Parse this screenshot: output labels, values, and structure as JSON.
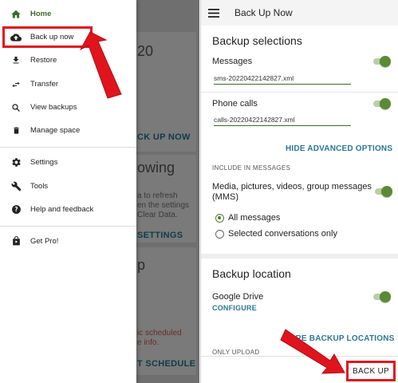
{
  "left_panel": {
    "background_app": {
      "card1_title": "20",
      "card1_button": "CK UP NOW",
      "card2_title": "owing",
      "card2_text": [
        "a to refresh",
        "en the settings",
        "Clear Data."
      ],
      "card2_button": "SETTINGS",
      "card3_title": "p",
      "card3_red_text": [
        "ic scheduled",
        "e info."
      ],
      "card3_button": "T SCHEDULE"
    },
    "drawer": {
      "items": [
        {
          "label": "Home",
          "icon": "home-icon"
        },
        {
          "label": "Back up now",
          "icon": "cloud-upload-icon"
        },
        {
          "label": "Restore",
          "icon": "download-icon"
        },
        {
          "label": "Transfer",
          "icon": "transfer-icon"
        },
        {
          "label": "View backups",
          "icon": "search-icon"
        },
        {
          "label": "Manage space",
          "icon": "trash-icon"
        },
        {
          "label": "Settings",
          "icon": "gear-icon"
        },
        {
          "label": "Tools",
          "icon": "wrench-icon"
        },
        {
          "label": "Help and feedback",
          "icon": "help-icon"
        },
        {
          "label": "Get Pro!",
          "icon": "pro-bag-icon"
        }
      ]
    }
  },
  "right_panel": {
    "appbar": {
      "title": "Back Up Now"
    },
    "backup_selections": {
      "heading": "Backup selections",
      "messages_label": "Messages",
      "messages_file": "sms-20220422142827.xml",
      "calls_label": "Phone calls",
      "calls_file": "calls-20220422142827.xml",
      "hide_advanced": "HIDE ADVANCED OPTIONS",
      "include_heading": "INCLUDE IN MESSAGES",
      "media_label": "Media, pictures, videos, group messages (MMS)",
      "radio_all": "All messages",
      "radio_selected": "Selected conversations only"
    },
    "backup_location": {
      "heading": "Backup location",
      "drive_label": "Google Drive",
      "configure": "CONFIGURE",
      "more_locations": "MORE BACKUP LOCATIONS",
      "only_upload": "ONLY UPLOAD"
    },
    "backup_button": "BACK UP"
  },
  "colors": {
    "accent_green": "#5b8a34",
    "link_blue": "#2b7891",
    "highlight_red": "#e0141c"
  }
}
